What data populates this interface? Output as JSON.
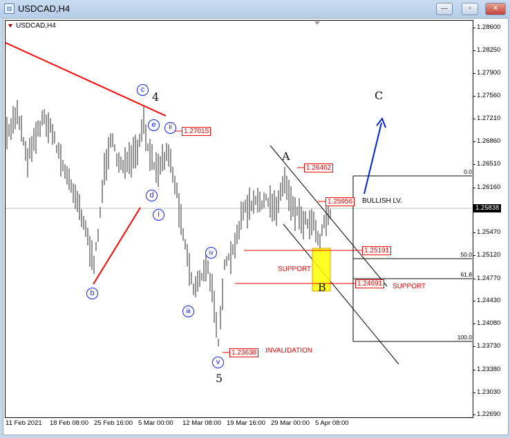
{
  "window": {
    "title": "USDCAD,H4",
    "minimize": "—",
    "restore": "▫",
    "close": "✕"
  },
  "chart_data": {
    "type": "ohlc",
    "symbol_label": "USDCAD,H4",
    "y_ticks": [
      "1.28600",
      "1.28250",
      "1.27900",
      "1.27560",
      "1.27210",
      "1.26860",
      "1.26510",
      "1.26160",
      "1.25470",
      "1.25120",
      "1.24770",
      "1.24430",
      "1.24080",
      "1.23730",
      "1.23380",
      "1.23030",
      "1.22690"
    ],
    "ylim": [
      1.2269,
      1.286
    ],
    "current_price": "1.25838",
    "x_ticks": [
      "11 Feb 2021",
      "18 Feb 08:00",
      "25 Feb 16:00",
      "5 Mar 00:00",
      "12 Mar 08:00",
      "19 Mar 16:00",
      "29 Mar 00:00",
      "5 Apr 08:00"
    ],
    "bar_count": 157,
    "price_path": [
      [
        0,
        1.26914
      ],
      [
        5,
        1.27335
      ],
      [
        10,
        1.26597
      ],
      [
        13,
        1.26914
      ],
      [
        18,
        1.2723
      ],
      [
        23,
        1.26914
      ],
      [
        28,
        1.26387
      ],
      [
        33,
        1.2607
      ],
      [
        38,
        1.25543
      ],
      [
        42,
        1.24911
      ],
      [
        47,
        1.26387
      ],
      [
        50,
        1.26914
      ],
      [
        53,
        1.26597
      ],
      [
        58,
        1.26492
      ],
      [
        63,
        1.26703
      ],
      [
        66,
        1.27124
      ],
      [
        69,
        1.26597
      ],
      [
        73,
        1.26492
      ],
      [
        78,
        1.26703
      ],
      [
        82,
        1.2607
      ],
      [
        87,
        1.25122
      ],
      [
        90,
        1.24595
      ],
      [
        93,
        1.24806
      ],
      [
        97,
        1.24911
      ],
      [
        100,
        1.24384
      ],
      [
        102,
        1.23857
      ],
      [
        105,
        1.24911
      ],
      [
        110,
        1.25227
      ],
      [
        113,
        1.25754
      ],
      [
        117,
        1.2586
      ],
      [
        123,
        1.25965
      ],
      [
        130,
        1.2586
      ],
      [
        134,
        1.26281
      ],
      [
        138,
        1.2586
      ],
      [
        143,
        1.25649
      ],
      [
        148,
        1.25649
      ],
      [
        151,
        1.25333
      ],
      [
        153,
        1.25649
      ],
      [
        156,
        1.25807
      ]
    ],
    "price_tags": [
      "1.27015",
      "1.26462",
      "1.25956",
      "1.25191",
      "1.24691",
      "1.23638"
    ],
    "wave_labels": {
      "c": "c",
      "e": "e",
      "ii": "ii",
      "d": "d",
      "i": "i",
      "iv": "iv",
      "iii": "iii",
      "b": "b",
      "v": "v",
      "four": "4",
      "five": "5",
      "A": "A",
      "B": "B",
      "C": "C"
    },
    "annotations": {
      "support1": "SUPPORT",
      "support2": "SUPPORT",
      "invalidation": "INVALIDATION",
      "bullish": "BULLISH LV."
    },
    "fib_levels": [
      "0.0",
      "50.0",
      "61.8",
      "100.0"
    ],
    "colors": {
      "bars": "#6e6e6e",
      "trend": "#ff0000",
      "arrow": "#0022dd",
      "zone": "#ffff00"
    }
  }
}
